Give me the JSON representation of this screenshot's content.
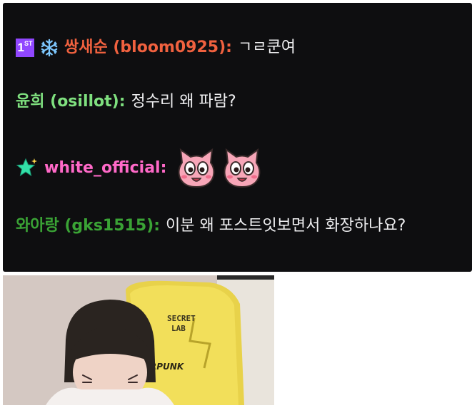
{
  "chat": {
    "messages": [
      {
        "username": "쌍새순 (bloom0925)",
        "name_color": "#f0613f",
        "text": "ㄱㄹ쿤여",
        "badges": [
          "first-badge",
          "snowflake-badge"
        ],
        "badge_first_label": "1",
        "badge_first_sup": "ST"
      },
      {
        "username": "윤희 (osillot)",
        "name_color": "#7fe07f",
        "text": "정수리 왜 파람?"
      },
      {
        "username": "white_official",
        "name_color": "#ff69c8",
        "badges": [
          "star-badge"
        ],
        "emotes": [
          "pink-cat-face-emote",
          "pink-cat-face-emote"
        ]
      },
      {
        "username": "와아랑 (gks1515)",
        "name_color": "#3aa335",
        "text": "이분 왜 포스트잇보면서 화장하나요?"
      }
    ],
    "colon": ":"
  },
  "video": {
    "chair_brand_line1": "SECRET",
    "chair_brand_line2": "LAB",
    "chair_text": "RPUNK"
  }
}
